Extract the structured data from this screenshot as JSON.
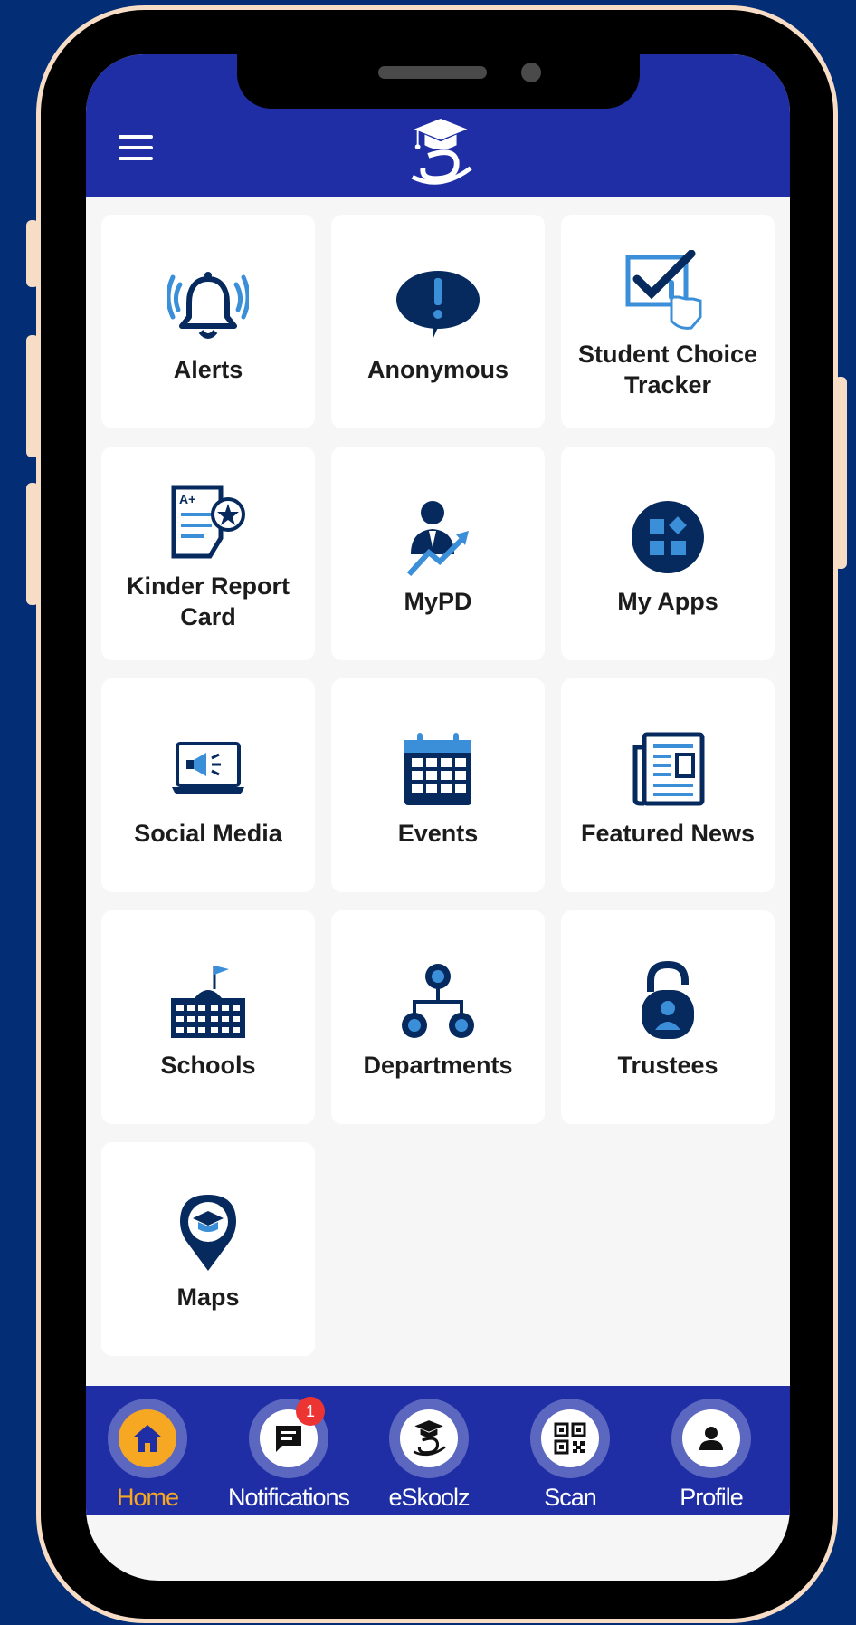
{
  "colors": {
    "background": "#032d74",
    "header": "#1f2ea5",
    "icon_primary": "#062a5e",
    "icon_accent": "#3b8fd9",
    "nav_active": "#f7a823",
    "badge": "#ec3433"
  },
  "header": {
    "menu_icon": "hamburger-menu-icon",
    "logo_icon": "eskoolz-graduation-cap-logo"
  },
  "tiles": [
    {
      "label": "Alerts",
      "icon": "bell-ringing-icon"
    },
    {
      "label": "Anonymous",
      "icon": "speech-bubble-exclamation-icon"
    },
    {
      "label": "Student Choice Tracker",
      "icon": "checkbox-hand-icon"
    },
    {
      "label": "Kinder Report Card",
      "icon": "report-card-icon"
    },
    {
      "label": "MyPD",
      "icon": "person-growth-chart-icon"
    },
    {
      "label": "My Apps",
      "icon": "apps-grid-icon"
    },
    {
      "label": "Social Media",
      "icon": "laptop-megaphone-icon"
    },
    {
      "label": "Events",
      "icon": "calendar-icon"
    },
    {
      "label": "Featured News",
      "icon": "newspaper-icon"
    },
    {
      "label": "Schools",
      "icon": "school-building-icon"
    },
    {
      "label": "Departments",
      "icon": "org-chart-icon"
    },
    {
      "label": "Trustees",
      "icon": "padlock-person-icon"
    },
    {
      "label": "Maps",
      "icon": "map-pin-graduation-icon"
    }
  ],
  "bottom_nav": [
    {
      "label": "Home",
      "icon": "home-icon",
      "active": true
    },
    {
      "label": "Notifications",
      "icon": "chat-message-icon",
      "badge": "1"
    },
    {
      "label": "eSkoolz",
      "icon": "eskoolz-logo-icon"
    },
    {
      "label": "Scan",
      "icon": "qr-code-icon"
    },
    {
      "label": "Profile",
      "icon": "user-profile-icon"
    }
  ]
}
